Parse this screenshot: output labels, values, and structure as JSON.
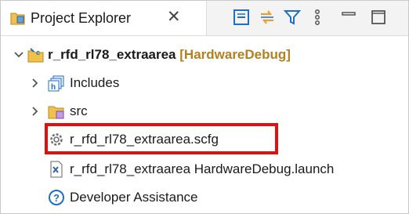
{
  "view": {
    "title": "Project Explorer",
    "close_icon": "close-icon",
    "toolbar": [
      "collapse-all-icon",
      "link-with-editor-icon",
      "filter-icon",
      "view-menu-icon",
      "minimize-icon",
      "maximize-icon"
    ]
  },
  "tree": {
    "project": {
      "name": "r_rfd_rl78_extraarea",
      "decoration": "[HardwareDebug]",
      "icon": "project-folder-icon",
      "expanded": true
    },
    "children": [
      {
        "label": "Includes",
        "icon": "includes-icon",
        "expandable": true
      },
      {
        "label": "src",
        "icon": "source-folder-icon",
        "expandable": true
      },
      {
        "label": "r_rfd_rl78_extraarea.scfg",
        "icon": "gear-icon",
        "highlighted": true
      },
      {
        "label": "r_rfd_rl78_extraarea HardwareDebug.launch",
        "icon": "launch-file-icon"
      },
      {
        "label": "Developer Assistance",
        "icon": "help-icon"
      }
    ]
  },
  "colors": {
    "highlight_border": "#e01010",
    "decoration": "#b2801e",
    "icon_blue": "#1f6fc5",
    "folder_gold": "#e8b640"
  }
}
